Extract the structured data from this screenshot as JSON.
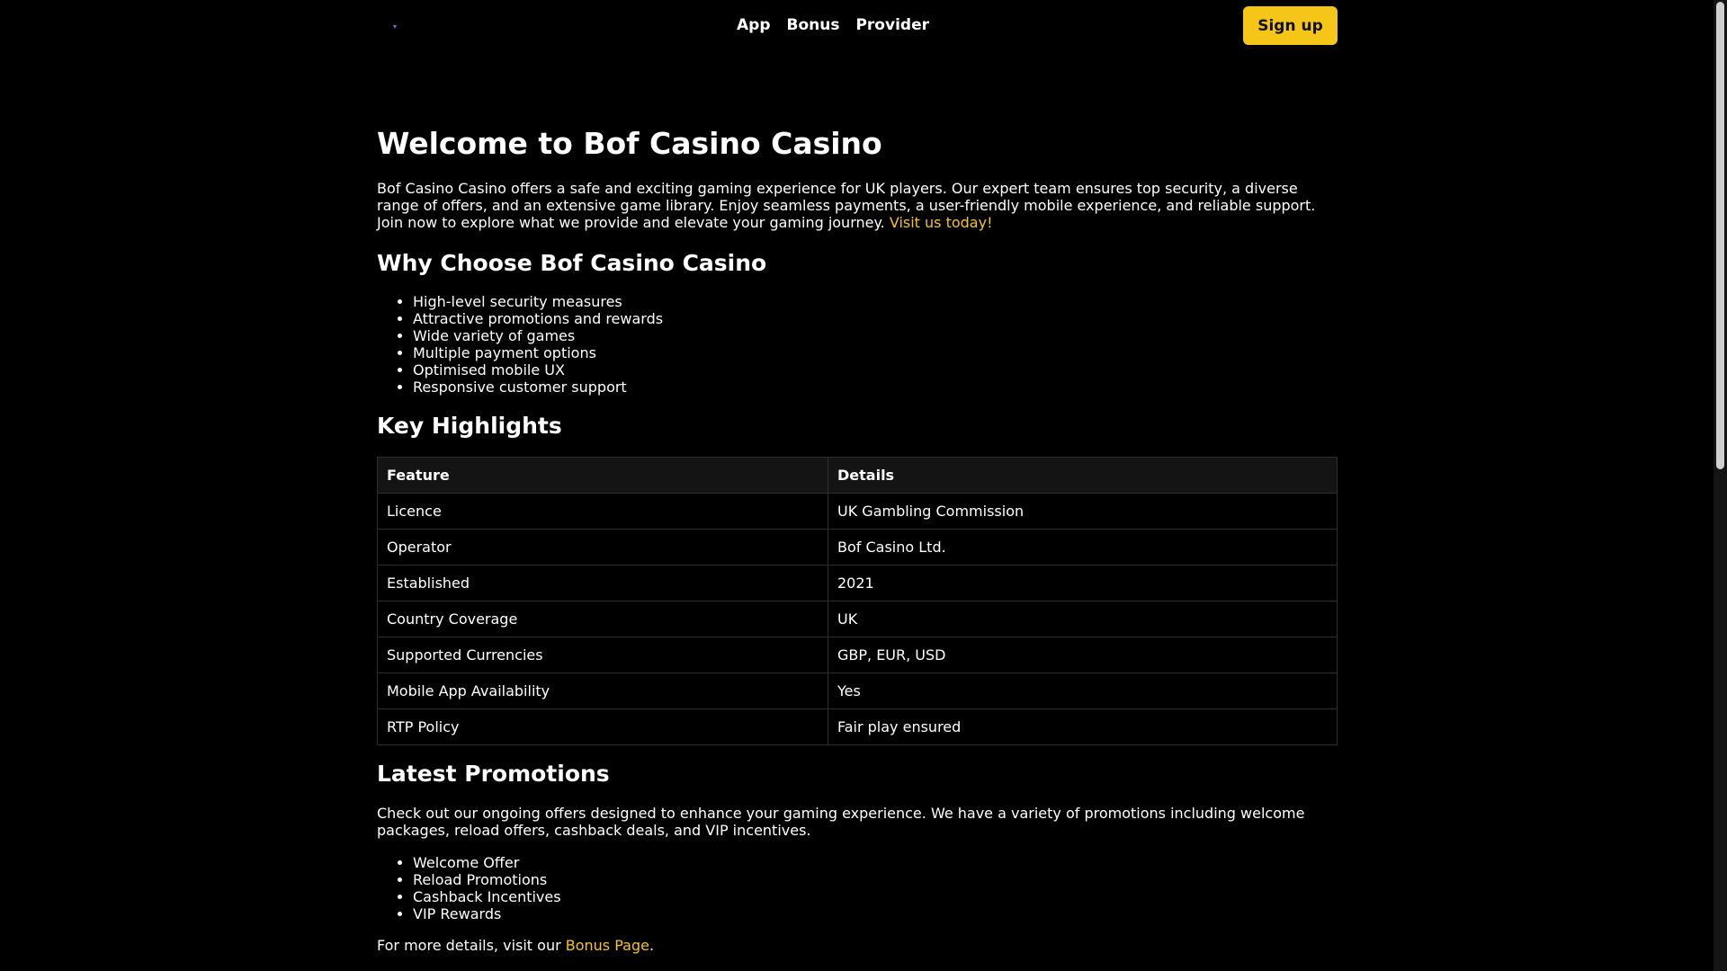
{
  "header": {
    "logo_glyph": "▾",
    "nav": [
      "App",
      "Bonus",
      "Provider"
    ],
    "signup_label": "Sign up"
  },
  "main": {
    "title": "Welcome to Bof Casino Casino",
    "intro_text": "Bof Casino Casino offers a safe and exciting gaming experience for UK players. Our expert team ensures top security, a diverse range of offers, and an extensive game library. Enjoy seamless payments, a user-friendly mobile experience, and reliable support. Join now to explore what we provide and elevate your gaming journey. ",
    "intro_link": "Visit us today!",
    "why": {
      "heading": "Why Choose Bof Casino Casino",
      "items": [
        "High-level security measures",
        "Attractive promotions and rewards",
        "Wide variety of games",
        "Multiple payment options",
        "Optimised mobile UX",
        "Responsive customer support"
      ]
    },
    "highlights": {
      "heading": "Key Highlights",
      "columns": [
        "Feature",
        "Details"
      ],
      "rows": [
        [
          "Licence",
          "UK Gambling Commission"
        ],
        [
          "Operator",
          "Bof Casino Ltd."
        ],
        [
          "Established",
          "2021"
        ],
        [
          "Country Coverage",
          "UK"
        ],
        [
          "Supported Currencies",
          "GBP, EUR, USD"
        ],
        [
          "Mobile App Availability",
          "Yes"
        ],
        [
          "RTP Policy",
          "Fair play ensured"
        ]
      ]
    },
    "promotions": {
      "heading": "Latest Promotions",
      "text": "Check out our ongoing offers designed to enhance your gaming experience. We have a variety of promotions including welcome packages, reload offers, cashback deals, and VIP incentives.",
      "items": [
        "Welcome Offer",
        "Reload Promotions",
        "Cashback Incentives",
        "VIP Rewards"
      ],
      "more_prefix": "For more details, visit our ",
      "more_link": "Bonus Page",
      "more_suffix": "."
    }
  },
  "colors": {
    "background": "#000000",
    "accent": "#f5c518",
    "text": "#ffffff"
  }
}
